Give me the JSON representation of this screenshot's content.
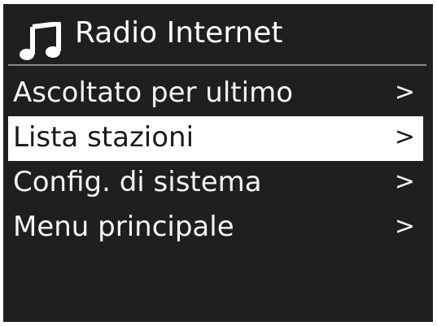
{
  "header": {
    "icon": "music-note-icon",
    "title": "Radio Internet"
  },
  "menu": {
    "items": [
      {
        "label": "Ascoltato per ultimo",
        "arrow": ">",
        "selected": false
      },
      {
        "label": "Lista stazioni",
        "arrow": ">",
        "selected": true
      },
      {
        "label": "Config. di sistema",
        "arrow": ">",
        "selected": false
      },
      {
        "label": "Menu principale",
        "arrow": ">",
        "selected": false
      }
    ]
  },
  "colors": {
    "background": "#1f1f1f",
    "text": "#f4f4f4",
    "selected_background": "#ffffff",
    "selected_text": "#1a1a1a"
  }
}
